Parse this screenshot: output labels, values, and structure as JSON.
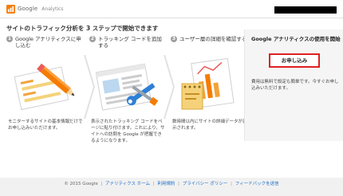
{
  "header": {
    "logo_text": "Google",
    "logo_sub": "Analytics"
  },
  "main": {
    "headline": "サイトのトラフィック分析を 3 ステップで開始できます",
    "steps": [
      {
        "num": "1",
        "title": "Google アナリティクスに申し込む",
        "desc": "モニターするサイトの基本情報だけでお申し込みいただけます。"
      },
      {
        "num": "2",
        "title": "トラッキング コードを追加する",
        "desc": "表示されたトラッキング コードをページに貼り付けます。これにより、サイトへの訪問を Google が把握できるようになります。"
      },
      {
        "num": "3",
        "title": "ユーザー層の詳細を確認する",
        "desc": "数時間以内にサイトの詳細データが表示されます。"
      }
    ],
    "cta": {
      "title": "Google アナリティクスの使用を開始",
      "button": "お申し込み",
      "note": "費用は無料で設定も簡単です。今すぐお申し込みいただけます。"
    }
  },
  "footer": {
    "copyright": "© 2015 Google",
    "links": [
      "アナリティクス ホーム",
      "利用規約",
      "プライバシー ポリシー",
      "フィードバックを送信"
    ]
  },
  "colors": {
    "signup_border": "#e02020",
    "link": "#1a6dcc"
  }
}
